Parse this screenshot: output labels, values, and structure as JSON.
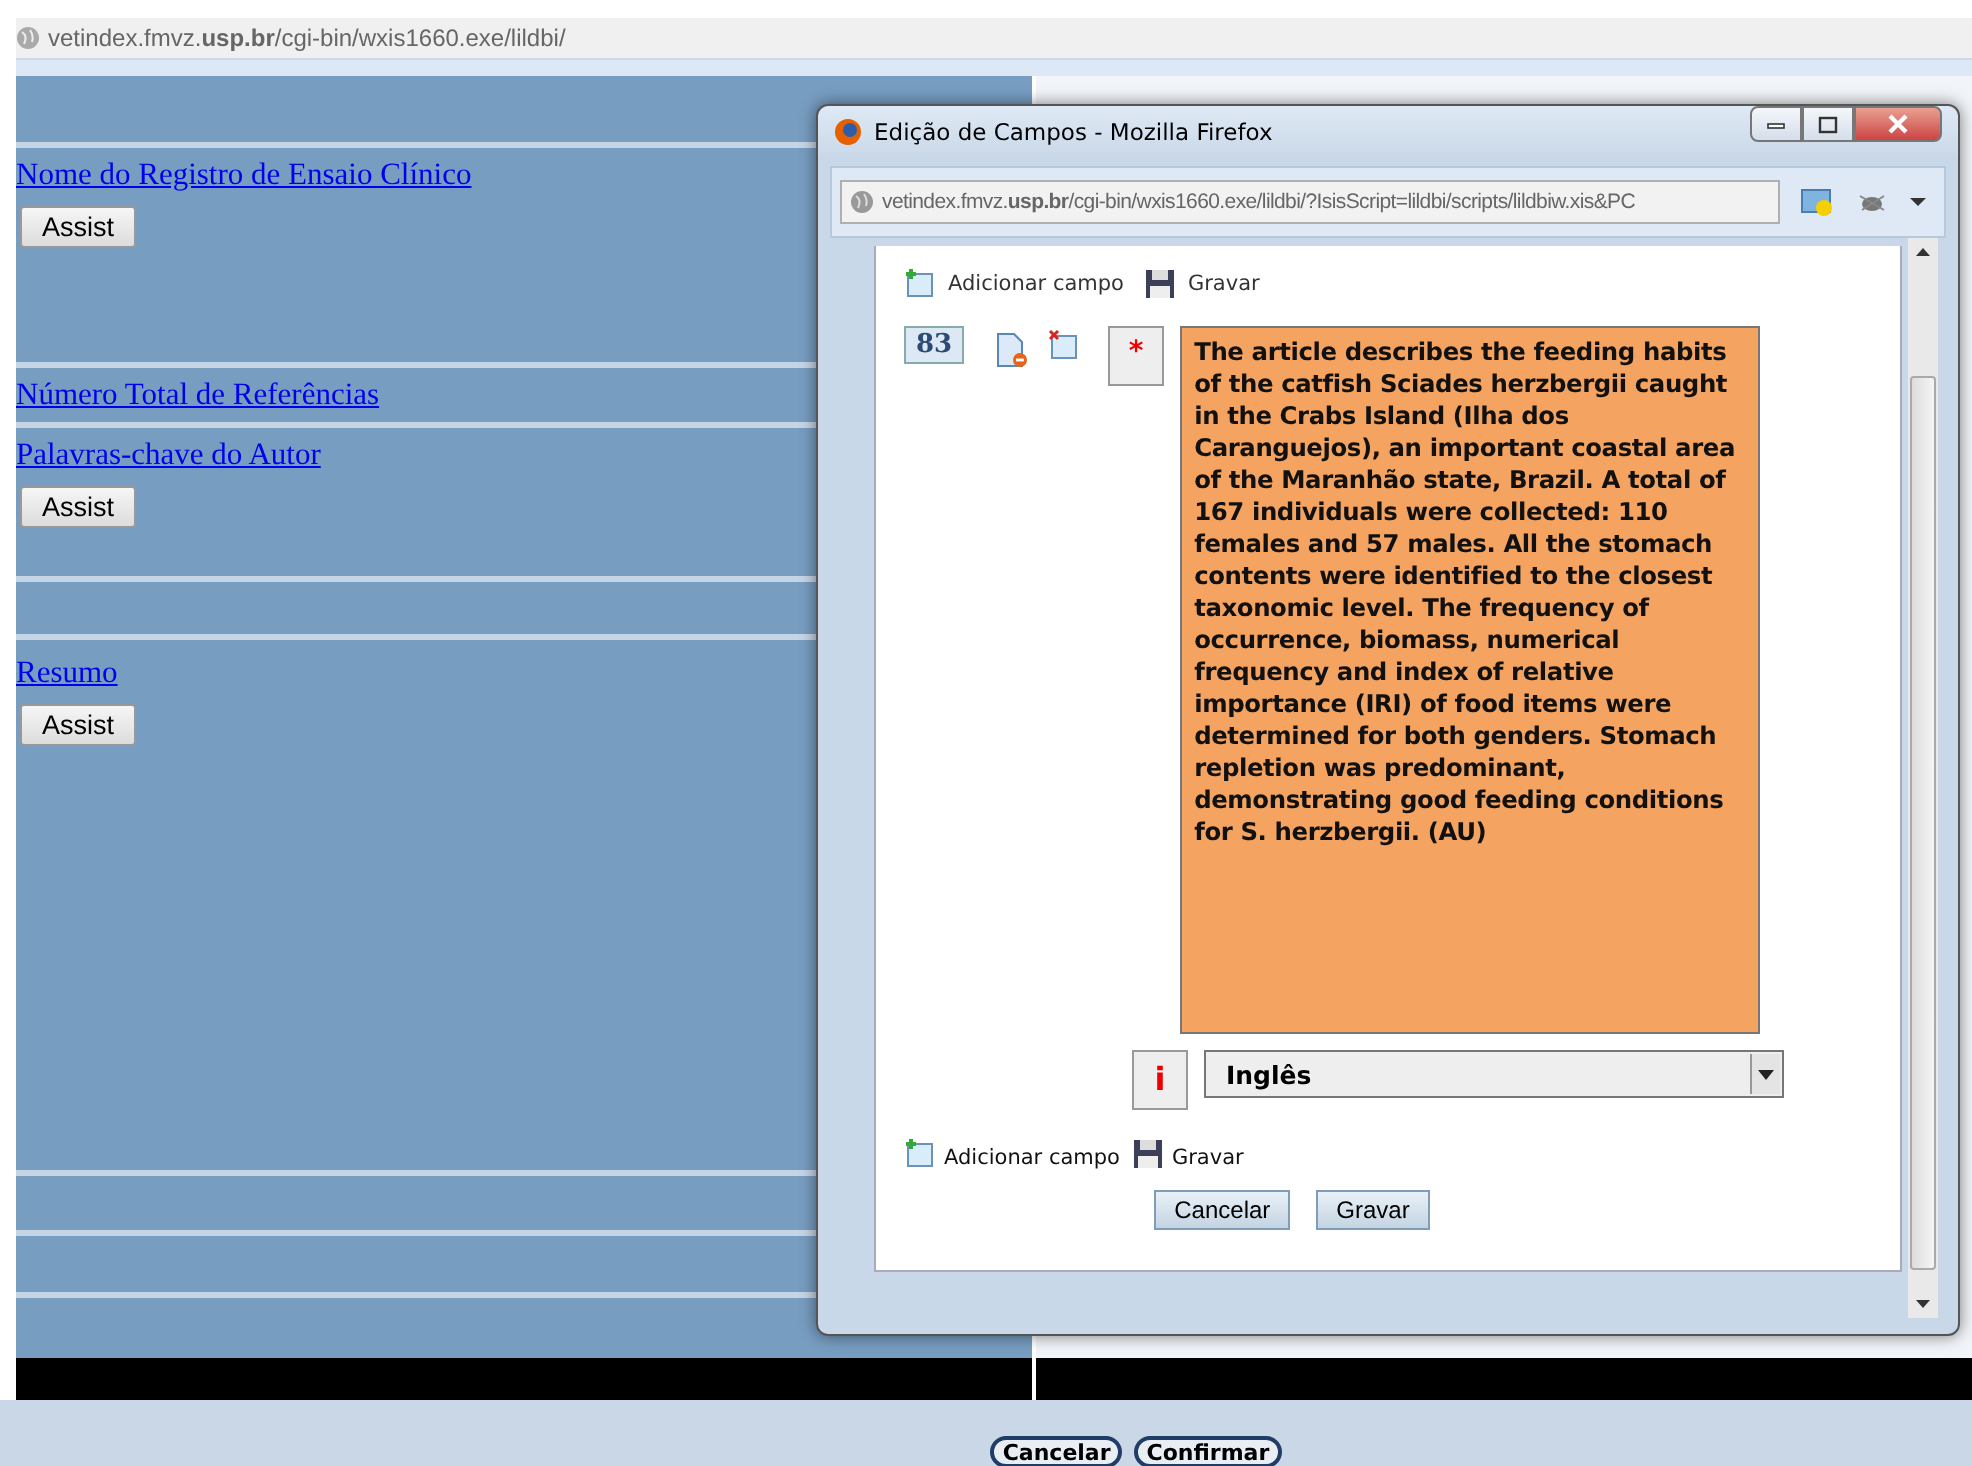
{
  "browser": {
    "url": "vetindex.fmvz.**usp.br**/cgi-bin/wxis1660.exe/lildbi/"
  },
  "page": {
    "rows": [
      {
        "kind": "empty"
      },
      {
        "kind": "field",
        "label": "Nome do Registro de Ensaio Clínico",
        "button": "Assist"
      },
      {
        "kind": "field",
        "label": "Número Total de Referências"
      },
      {
        "kind": "field",
        "label": "Palavras-chave do Autor",
        "button": "Assist"
      },
      {
        "kind": "empty"
      },
      {
        "kind": "field",
        "label": "Resumo",
        "button": "Assist"
      },
      {
        "kind": "empty"
      },
      {
        "kind": "empty"
      },
      {
        "kind": "empty"
      }
    ],
    "footer_buttons": [
      "Cancelar",
      "Confirmar"
    ]
  },
  "popup": {
    "title": "Edição de Campos - Mozilla Firefox",
    "url": "vetindex.fmvz.**usp.br**/cgi-bin/wxis1660.exe/lildbi/?IsisScript=lildbi/scripts/lildbiw.xis&PC",
    "toolbar_top": [
      {
        "kind": "add",
        "label": "Adicionar campo"
      },
      {
        "kind": "save",
        "label": "Gravar"
      }
    ],
    "field_tag": "83",
    "required_mark": "*",
    "text": "The article describes the feeding habits of the catfish Sciades herzbergii caught in the Crabs Island (Ilha dos Caranguejos), an important coastal area of the Maranhão state, Brazil. A total of 167 individuals were collected: 110 females and 57 males. All the stomach contents were identified to the closest taxonomic level. The frequency of occurrence, biomass, numerical frequency and index of relative importance (IRI) of food items were determined for both genders. Stomach repletion was predominant, demonstrating good feeding conditions for S. herzbergii. (AU)",
    "language_mark": "i",
    "language": "Inglês",
    "toolbar_bottom": [
      {
        "kind": "add",
        "label": "Adicionar campo"
      },
      {
        "kind": "save",
        "label": "Gravar"
      }
    ],
    "buttons": [
      "Cancelar",
      "Gravar"
    ]
  }
}
